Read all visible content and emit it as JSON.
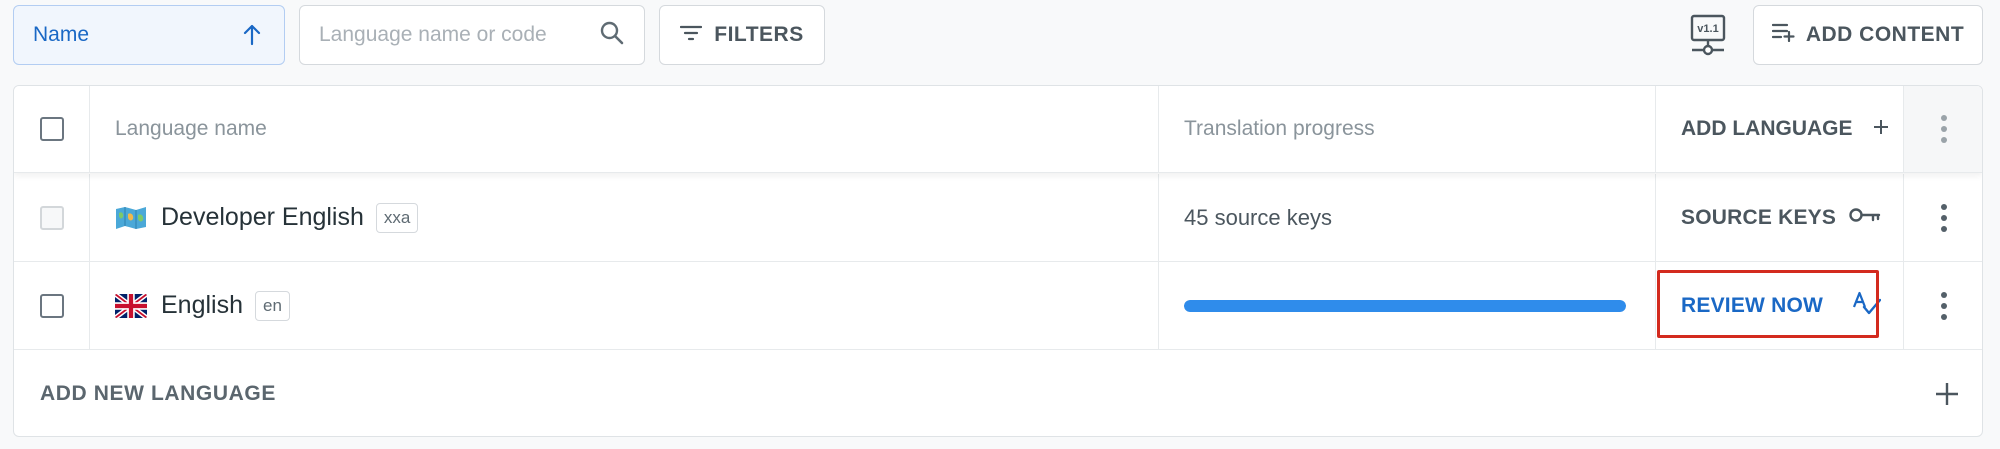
{
  "toolbar": {
    "sort": {
      "label": "Name",
      "direction_icon": "arrow-up-icon"
    },
    "search": {
      "value": "",
      "placeholder": "Language name or code",
      "icon": "search-icon"
    },
    "filters_label": "FILTERS",
    "version_icon": "v1.1",
    "add_content_label": "ADD CONTENT"
  },
  "table": {
    "headers": {
      "language_name": "Language name",
      "translation_progress": "Translation progress",
      "add_language": "ADD LANGUAGE"
    },
    "rows": [
      {
        "flag_icon": "world-map-icon",
        "name": "Developer English",
        "code": "xxa",
        "progress_text": "45 source keys",
        "action_label": "SOURCE KEYS",
        "action_icon": "key-icon",
        "checkbox_disabled": true
      },
      {
        "flag_icon": "uk-flag-icon",
        "name": "English",
        "code": "en",
        "progress_fraction": 1.0,
        "action_label": "REVIEW NOW",
        "action_icon": "spellcheck-icon",
        "checkbox_disabled": false
      }
    ],
    "add_new_language_label": "ADD NEW LANGUAGE"
  },
  "colors": {
    "accent": "#1a68c5",
    "progress": "#2f8ceb",
    "highlight": "#d32a1e"
  }
}
